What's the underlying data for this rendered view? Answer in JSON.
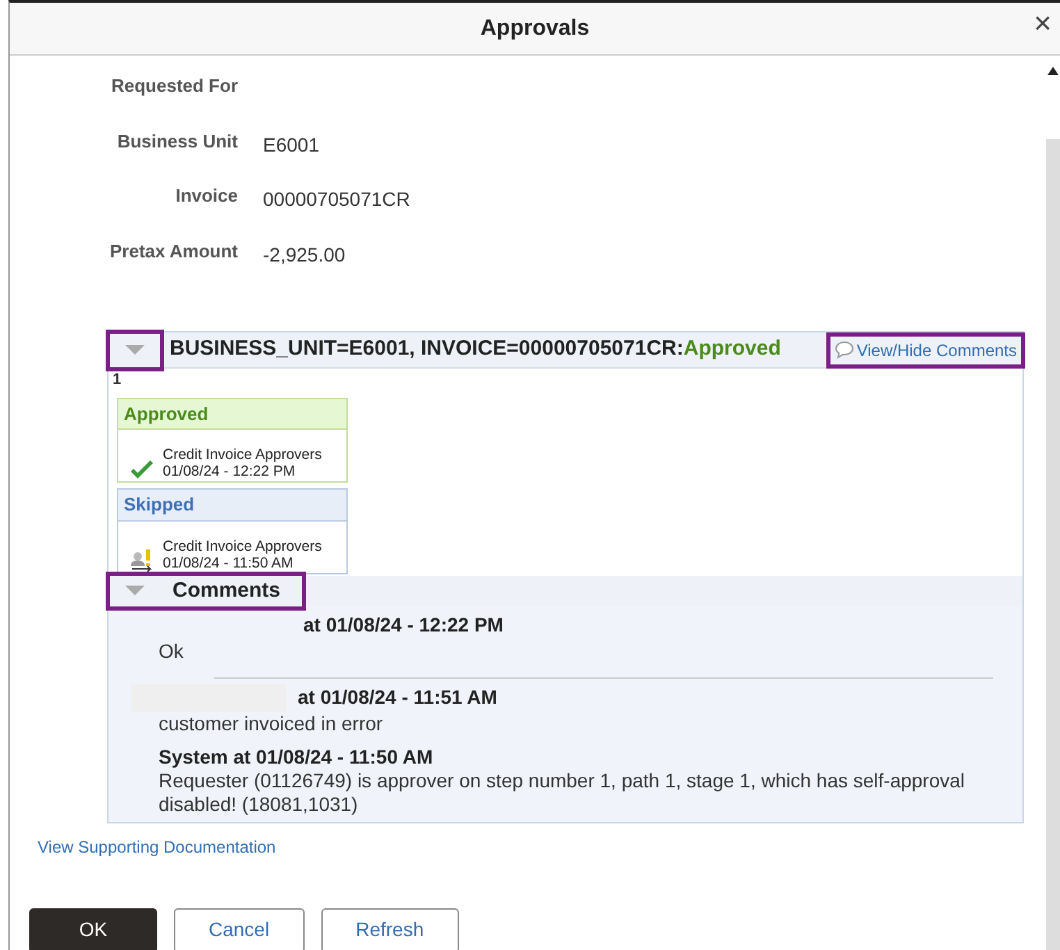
{
  "window": {
    "title": "Approvals",
    "close": "×"
  },
  "fields": [
    {
      "label": "Requested For"
    },
    {
      "label": "Business Unit",
      "value": "E6001"
    },
    {
      "label": "Invoice",
      "value": "00000705071CR"
    },
    {
      "label": "Pretax Amount",
      "value": "-2,925.00"
    }
  ],
  "approval": {
    "expanded": true,
    "highlighted": true,
    "title": "BUSINESS_UNIT=E6001, INVOICE=00000705071CR:",
    "status": "Approved",
    "comments_link": {
      "label": "View/Hide Comments",
      "highlighted": true
    },
    "path_number": "1",
    "stages": [
      {
        "kind": "approved",
        "status": "Approved",
        "color": "#4b8a1c",
        "name": "Credit Invoice Approvers",
        "time": "01/08/24 - 12:22 PM"
      },
      {
        "kind": "skipped",
        "status": "Skipped",
        "color": "#3f6fb5",
        "name": "Credit Invoice Approvers",
        "time": "01/08/24 - 11:50 AM"
      }
    ]
  },
  "comments": {
    "title": "Comments",
    "expanded": true,
    "highlighted": true,
    "items": [
      {
        "author_hidden": true,
        "header": "at 01/08/24 - 12:22 PM",
        "text": "Ok"
      },
      {
        "author_hidden": true,
        "header": "at 01/08/24 - 11:51 AM",
        "text": "customer invoiced in error"
      },
      {
        "author_hidden": false,
        "header": "System at 01/08/24 - 11:50 AM",
        "text": "Requester (01126749) is approver on step number 1, path 1, stage 1, which has self-approval disabled! (18081,1031)"
      }
    ]
  },
  "doc_link": "View Supporting Documentation",
  "buttons": [
    {
      "label": "OK",
      "primary": true
    },
    {
      "label": "Cancel",
      "primary": false
    },
    {
      "label": "Refresh",
      "primary": false
    }
  ]
}
